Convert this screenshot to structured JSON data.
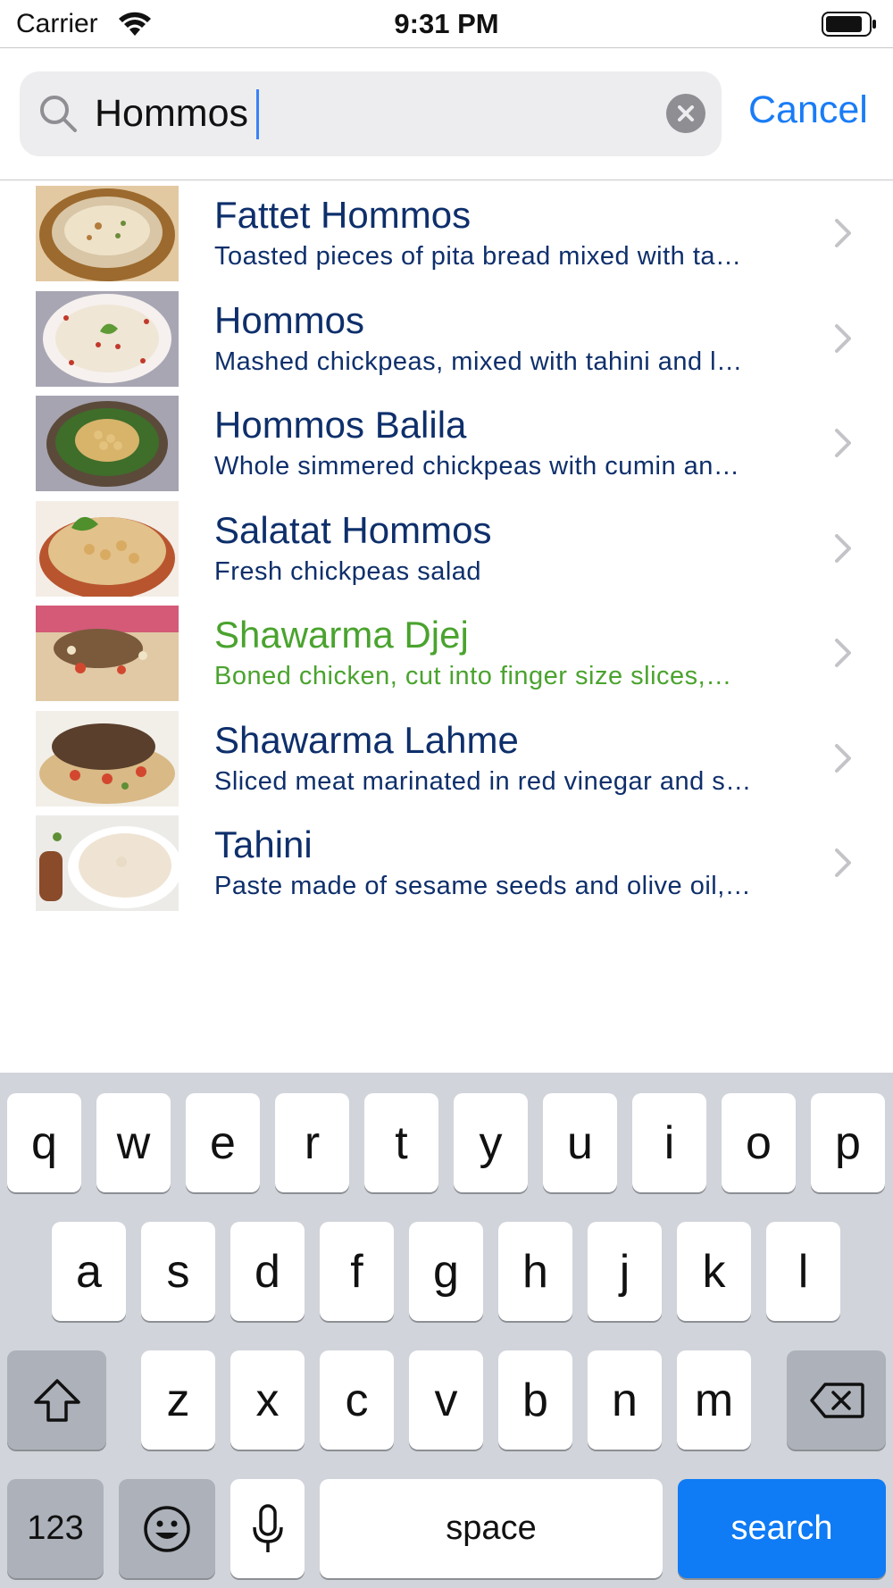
{
  "status_bar": {
    "carrier": "Carrier",
    "time": "9:31 PM",
    "icons": [
      "wifi-icon",
      "battery-icon"
    ]
  },
  "search": {
    "value": "Hommos",
    "cancel_label": "Cancel",
    "icons": [
      "search-icon",
      "clear-icon"
    ]
  },
  "results": [
    {
      "title": "Fattet Hommos",
      "subtitle": "Toasted pieces of pita bread mixed with ta…",
      "highlighted": false
    },
    {
      "title": "Hommos",
      "subtitle": "Mashed chickpeas, mixed with tahini and l…",
      "highlighted": false
    },
    {
      "title": "Hommos Balila",
      "subtitle": "Whole simmered chickpeas with cumin an…",
      "highlighted": false
    },
    {
      "title": "Salatat Hommos",
      "subtitle": "Fresh chickpeas salad",
      "highlighted": false
    },
    {
      "title": "Shawarma Djej",
      "subtitle": "Boned chicken, cut into finger size slices,…",
      "highlighted": true
    },
    {
      "title": "Shawarma Lahme",
      "subtitle": "Sliced meat marinated in red vinegar and s…",
      "highlighted": false
    },
    {
      "title": "Tahini",
      "subtitle": "Paste made of sesame seeds and olive oil,…",
      "highlighted": false
    }
  ],
  "colors": {
    "title_text": "#0e2f6b",
    "highlight_text": "#4aa32e",
    "accent": "#1a7cf6",
    "keyboard_bg": "#d1d4da"
  },
  "keyboard": {
    "row1": [
      "q",
      "w",
      "e",
      "r",
      "t",
      "y",
      "u",
      "i",
      "o",
      "p"
    ],
    "row2": [
      "a",
      "s",
      "d",
      "f",
      "g",
      "h",
      "j",
      "k",
      "l"
    ],
    "row3": [
      "z",
      "x",
      "c",
      "v",
      "b",
      "n",
      "m"
    ],
    "numbers_label": "123",
    "space_label": "space",
    "search_label": "search",
    "icons": [
      "shift-icon",
      "delete-icon",
      "emoji-icon",
      "microphone-icon"
    ]
  }
}
